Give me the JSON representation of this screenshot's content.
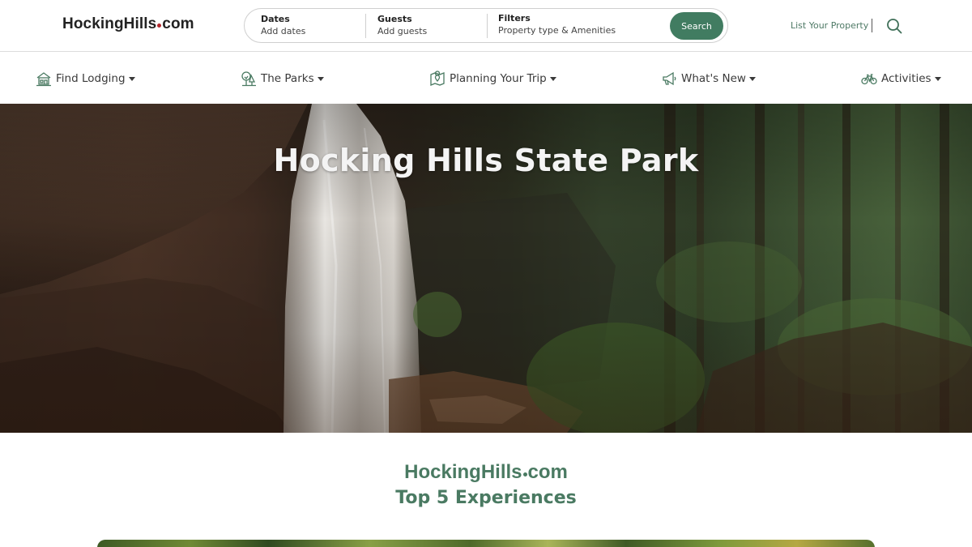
{
  "header": {
    "logo_left": "HockingHills",
    "logo_right": "com",
    "search": {
      "dates_label": "Dates",
      "dates_value": "Add dates",
      "guests_label": "Guests",
      "guests_value": "Add guests",
      "filters_label": "Filters",
      "filters_value": "Property type & Amenities",
      "button_label": "Search"
    },
    "list_property": "List Your Property"
  },
  "nav": {
    "items": [
      {
        "label": "Find Lodging",
        "icon": "house-icon"
      },
      {
        "label": "The Parks",
        "icon": "trees-icon"
      },
      {
        "label": "Planning Your Trip",
        "icon": "map-icon"
      },
      {
        "label": "What's New",
        "icon": "megaphone-icon"
      },
      {
        "label": "Activities",
        "icon": "bicycle-icon"
      }
    ]
  },
  "hero": {
    "title": "Hocking Hills State Park"
  },
  "section": {
    "logo_left": "HockingHills",
    "logo_right": "com",
    "title": "Top 5 Experiences"
  },
  "colors": {
    "brand_green": "#417c61",
    "heading_green": "#4a7a62",
    "logo_dot_red": "#b3262b"
  }
}
